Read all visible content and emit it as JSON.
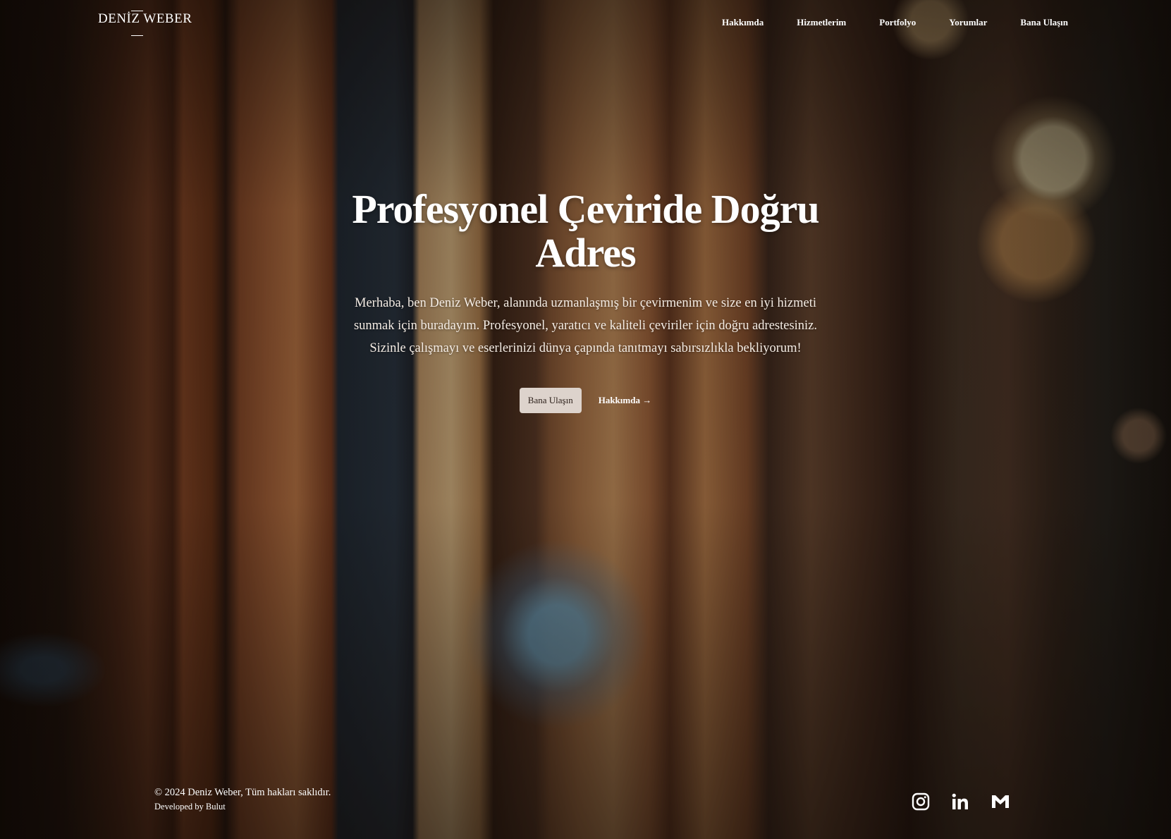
{
  "header": {
    "logo": "DENİZ WEBER",
    "nav": [
      "Hakkımda",
      "Hizmetlerim",
      "Portfolyo",
      "Yorumlar",
      "Bana Ulaşın"
    ]
  },
  "hero": {
    "title": "Profesyonel Çeviride Doğru Adres",
    "description": "Merhaba, ben Deniz Weber, alanında uzmanlaşmış bir çevirmenim ve size en iyi hizmeti sunmak için buradayım. Profesyonel, yaratıcı ve kaliteli çeviriler için doğru adrestesiniz. Sizinle çalışmayı ve eserlerinizi dünya çapında tanıtmayı sabırsızlıkla bekliyorum!",
    "primary_button": "Bana Ulaşın",
    "secondary_link": "Hakkımda →"
  },
  "footer": {
    "copyright": "© 2024 Deniz Weber, Tüm hakları saklıdır.",
    "developer": "Developed by Bulut",
    "social_icons": [
      "instagram-icon",
      "linkedin-icon",
      "gmail-icon"
    ]
  }
}
